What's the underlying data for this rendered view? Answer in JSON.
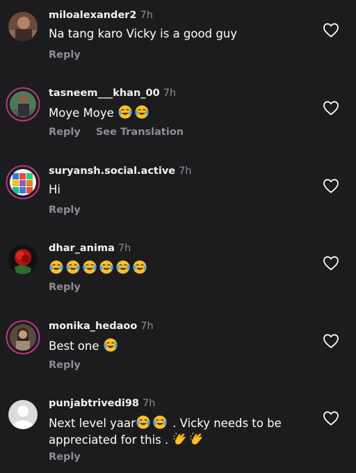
{
  "comments": [
    {
      "username": "miloalexander2",
      "time": "7h",
      "text": "Na tang karo Vicky is a good guy",
      "reply_label": "Reply",
      "avatar": "avatar-photo"
    },
    {
      "username": "tasneem___khan_00",
      "time": "7h",
      "text": "Moye Moye",
      "emoji_after": [
        "face-with-tears-of-joy",
        "face-with-tears-of-joy"
      ],
      "reply_label": "Reply",
      "translation_label": "See Translation",
      "avatar": "avatar-photo-with-story-ring"
    },
    {
      "username": "suryansh.social.active",
      "time": "7h",
      "text": "Hi",
      "reply_label": "Reply",
      "avatar": "avatar-photo-with-story-ring"
    },
    {
      "username": "dhar_anima",
      "time": "7h",
      "text": "",
      "emoji_after": [
        "face-with-tears-of-joy",
        "face-with-tears-of-joy",
        "face-with-tears-of-joy",
        "face-with-tears-of-joy",
        "face-with-tears-of-joy",
        "face-with-tears-of-joy"
      ],
      "reply_label": "Reply",
      "avatar": "rose-photo"
    },
    {
      "username": "monika_hedaoo",
      "time": "7h",
      "text": "Best one",
      "emoji_after": [
        "face-with-tears-of-joy"
      ],
      "reply_label": "Reply",
      "avatar": "avatar-photo-with-story-ring"
    },
    {
      "username": "punjabtrivedi98",
      "time": "7h",
      "text_part1": "Next level yaar",
      "emoji_mid": [
        "face-with-tears-of-joy",
        "face-with-tears-of-joy"
      ],
      "text_part2": " . Vicky needs to be appreciated for this . ",
      "emoji_end": [
        "clapping-hands",
        "clapping-hands"
      ],
      "reply_label": "Reply",
      "avatar": "default-avatar"
    }
  ],
  "colors": {
    "background": "#1c1c1e",
    "username": "#f2f2f2",
    "secondary_text": "#8e8e93",
    "story_ring": "#c13584",
    "emoji_yellow": "#f7c12b",
    "emoji_tears": "#4fa6ee"
  }
}
